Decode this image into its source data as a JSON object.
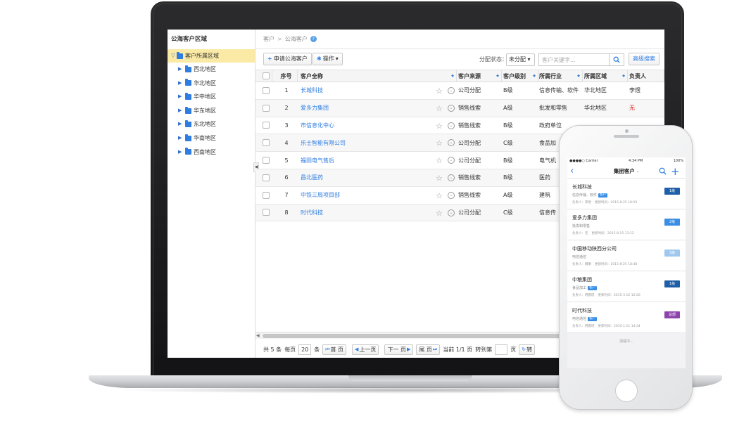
{
  "sidebar": {
    "title": "公海客户区域",
    "root": "客户所属区域",
    "items": [
      "西北地区",
      "华北地区",
      "华中地区",
      "华东地区",
      "东北地区",
      "华南地区",
      "西南地区"
    ]
  },
  "breadcrumb": {
    "parent": "客户",
    "separator": ">",
    "current": "公海客户",
    "help": "?"
  },
  "toolbar": {
    "apply_label": "申请公海客户",
    "action_label": "操作",
    "status_label": "分配状态：",
    "status_value": "未分配",
    "search_placeholder": "客户关键字...",
    "advanced_label": "高级搜索"
  },
  "table": {
    "headers": {
      "seq": "序号",
      "name": "客户全称",
      "source": "客户来源",
      "level": "客户级别",
      "industry": "所属行业",
      "region": "所属区域",
      "owner": "负责人"
    },
    "rows": [
      {
        "seq": "1",
        "name": "长城科技",
        "source": "公司分配",
        "level": "B级",
        "industry": "信息传输、软件",
        "region": "华北地区",
        "owner": "李煜",
        "owner_red": false
      },
      {
        "seq": "2",
        "name": "爱多力集团",
        "source": "销售线索",
        "level": "A级",
        "industry": "批发和零售",
        "region": "华北地区",
        "owner": "无",
        "owner_red": true
      },
      {
        "seq": "3",
        "name": "市信息化中心",
        "source": "销售线索",
        "level": "B级",
        "industry": "政府单位",
        "region": "",
        "owner": "",
        "owner_red": false
      },
      {
        "seq": "4",
        "name": "乐士智能有限公司",
        "source": "公司分配",
        "level": "C级",
        "industry": "食品加",
        "region": "",
        "owner": "",
        "owner_red": false
      },
      {
        "seq": "5",
        "name": "福田电气售后",
        "source": "公司分配",
        "level": "B级",
        "industry": "电气机",
        "region": "",
        "owner": "",
        "owner_red": false
      },
      {
        "seq": "6",
        "name": "昌北医药",
        "source": "销售线索",
        "level": "B级",
        "industry": "医药",
        "region": "",
        "owner": "",
        "owner_red": false
      },
      {
        "seq": "7",
        "name": "中铁三局项目部",
        "source": "销售线索",
        "level": "A级",
        "industry": "建筑",
        "region": "",
        "owner": "",
        "owner_red": false
      },
      {
        "seq": "8",
        "name": "时代科技",
        "source": "公司分配",
        "level": "C级",
        "industry": "信息传",
        "region": "",
        "owner": "",
        "owner_red": false
      }
    ]
  },
  "pager": {
    "total_prefix": "共 5 条",
    "per_page_label": "每页",
    "per_page_value": "20",
    "per_page_unit": "条",
    "first": "首 页",
    "prev": "上一页",
    "next": "下一 页",
    "last": "尾 页",
    "current": "当前 1/1 页",
    "goto_label": "转到第",
    "goto_value": "",
    "goto_unit": "页",
    "go": "转"
  },
  "phone": {
    "status": {
      "carrier": "●●●●○ Carrier",
      "time": "4:34 PM",
      "battery": "100%"
    },
    "title": "集团客户",
    "cards": [
      {
        "name": "长城科技",
        "sub": "信息传输、软件",
        "tag": "客户",
        "owner": "负责人：李煜",
        "time": "更新时间：2015-8-25 18:50",
        "badge": "1级",
        "badge_color": "#1f5fa8"
      },
      {
        "name": "爱多力集团",
        "sub": "批发和零售",
        "tag": "",
        "owner": "负责人：无",
        "time": "更新时间：2015-8-15 13:12",
        "badge": "2级",
        "badge_color": "#3a8ee6"
      },
      {
        "name": "中国移动陕西分公司",
        "sub": "电信通信",
        "tag": "",
        "owner": "负责人：魏明",
        "time": "更新时间：2015-8-25 18:48",
        "badge": "3级",
        "badge_color": "#9fc8f0"
      },
      {
        "name": "中粮集团",
        "sub": "食品加工",
        "tag": "客户",
        "owner": "负责人：韩嘉瑶",
        "time": "更新时间：2015-3-12 10:26",
        "badge": "1级",
        "badge_color": "#1f5fa8"
      },
      {
        "name": "时代科技",
        "sub": "电信通信",
        "tag": "客户",
        "owner": "负责人：韩嘉瑶",
        "time": "更新时间：2015-1-11 14:34",
        "badge": "总部",
        "badge_color": "#8e44ad"
      }
    ],
    "loading": "加载中..."
  }
}
